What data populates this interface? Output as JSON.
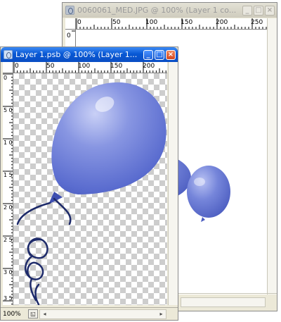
{
  "back_window": {
    "title": "0060061_MED.JPG @ 100% (Layer 1 co...",
    "controls": {
      "minimize": "_",
      "maximize": "□",
      "close": "×"
    },
    "ruler_h_labels": [
      "0",
      "50",
      "100",
      "150",
      "200",
      "250"
    ],
    "ruler_v_labels": [
      "0"
    ]
  },
  "front_window": {
    "title": "Layer 1.psb @ 100% (Layer 1...",
    "controls": {
      "minimize": "_",
      "maximize": "□",
      "close": "×"
    },
    "ruler_h_labels": [
      "0",
      "50",
      "100",
      "150",
      "200"
    ],
    "ruler_v_labels": [
      "0",
      "5 0",
      "1 0 0",
      "1 5 0",
      "2 0 0",
      "2 5 0",
      "3 0 0",
      "3 5"
    ],
    "zoom": "100%"
  },
  "colors": {
    "balloon": "#6b7cd6",
    "balloon_light": "#a7b3ef",
    "ribbon": "#1d2a6a"
  }
}
